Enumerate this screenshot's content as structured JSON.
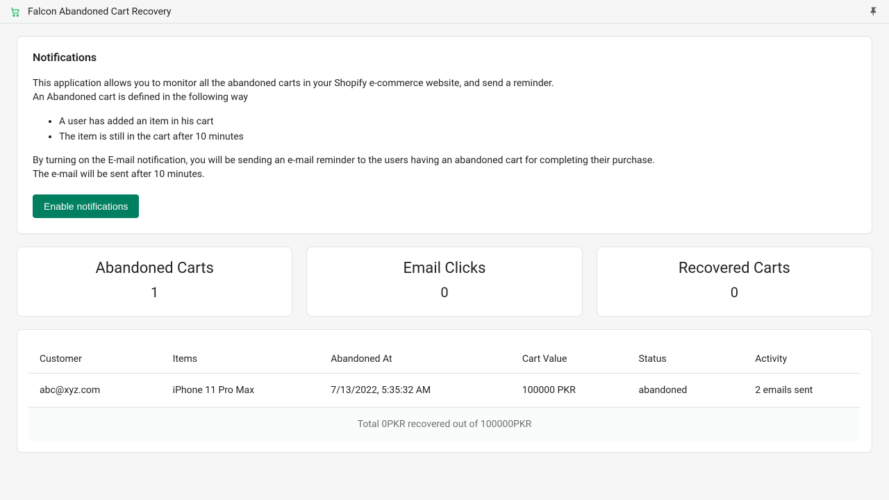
{
  "header": {
    "app_title": "Falcon Abandoned Cart Recovery"
  },
  "notifications": {
    "heading": "Notifications",
    "intro_line1": "This application allows you to monitor all the abandoned carts in your Shopify e-commerce website, and send a reminder.",
    "intro_line2": "An Abandoned cart is defined in the following way",
    "bullets": [
      "A user has added an item in his cart",
      "The item is still in the cart after 10 minutes"
    ],
    "outro_line1": "By turning on the E-mail notification, you will be sending an e-mail reminder to the users having an abandoned cart for completing their purchase.",
    "outro_line2": "The e-mail will be sent after 10 minutes.",
    "enable_button": "Enable notifications"
  },
  "stats": [
    {
      "title": "Abandoned Carts",
      "value": "1"
    },
    {
      "title": "Email Clicks",
      "value": "0"
    },
    {
      "title": "Recovered Carts",
      "value": "0"
    }
  ],
  "table": {
    "columns": [
      "Customer",
      "Items",
      "Abandoned At",
      "Cart Value",
      "Status",
      "Activity"
    ],
    "rows": [
      {
        "customer": "abc@xyz.com",
        "items": "iPhone 11 Pro Max",
        "abandoned_at": "7/13/2022, 5:35:32 AM",
        "cart_value": "100000 PKR",
        "status": "abandoned",
        "activity": "2 emails sent"
      }
    ],
    "footer": "Total 0PKR recovered out of 100000PKR"
  }
}
